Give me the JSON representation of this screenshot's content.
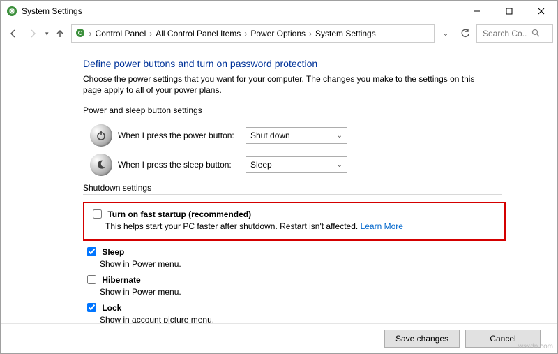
{
  "window": {
    "title": "System Settings"
  },
  "breadcrumb": {
    "items": [
      "Control Panel",
      "All Control Panel Items",
      "Power Options",
      "System Settings"
    ]
  },
  "search": {
    "placeholder": "Search Co..."
  },
  "heading": "Define power buttons and turn on password protection",
  "description": "Choose the power settings that you want for your computer. The changes you make to the settings on this page apply to all of your power plans.",
  "sections": {
    "power_sleep_header": "Power and sleep button settings",
    "power_button_label": "When I press the power button:",
    "power_button_value": "Shut down",
    "sleep_button_label": "When I press the sleep button:",
    "sleep_button_value": "Sleep",
    "shutdown_header": "Shutdown settings"
  },
  "options": {
    "fast_startup": {
      "title": "Turn on fast startup (recommended)",
      "desc": "This helps start your PC faster after shutdown. Restart isn't affected. ",
      "learn_more": "Learn More",
      "checked": false
    },
    "sleep": {
      "title": "Sleep",
      "desc": "Show in Power menu.",
      "checked": true
    },
    "hibernate": {
      "title": "Hibernate",
      "desc": "Show in Power menu.",
      "checked": false
    },
    "lock": {
      "title": "Lock",
      "desc": "Show in account picture menu.",
      "checked": true
    }
  },
  "footer": {
    "save": "Save changes",
    "cancel": "Cancel"
  },
  "watermark": "wsxdn.com"
}
